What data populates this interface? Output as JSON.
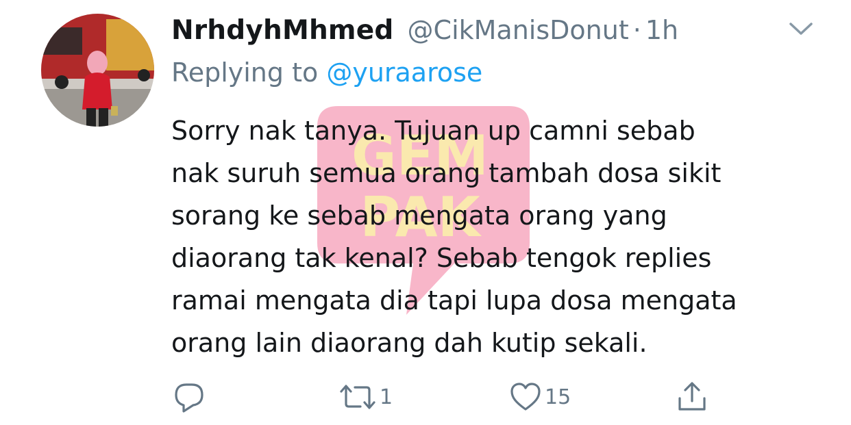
{
  "tweet": {
    "display_name": "NrhdyhMhmed",
    "handle": "@CikManisDonut",
    "separator": "·",
    "time": "1h",
    "replying_prefix": "Replying to",
    "replying_to": "@yuraarose",
    "body_lines": [
      "Sorry nak tanya. Tujuan up camni sebab",
      "nak suruh semua orang tambah dosa sikit",
      "sorang ke sebab mengata orang yang",
      "diaorang tak kenal? Sebab tengok replies",
      "ramai mengata dia tapi lupa dosa mengata",
      "orang lain diaorang dah kutip sekali."
    ],
    "actions": {
      "reply_icon": "reply-icon",
      "retweet_icon": "retweet-icon",
      "retweet_count": "1",
      "like_icon": "heart-icon",
      "like_count": "15",
      "share_icon": "share-icon"
    }
  },
  "watermark": {
    "brand_top": "GEM",
    "brand_bottom": "PAK",
    "color": "#f0608a",
    "text_color": "#f6d04d"
  },
  "colors": {
    "name": "#14171a",
    "secondary": "#657786",
    "link": "#1da1f2"
  }
}
